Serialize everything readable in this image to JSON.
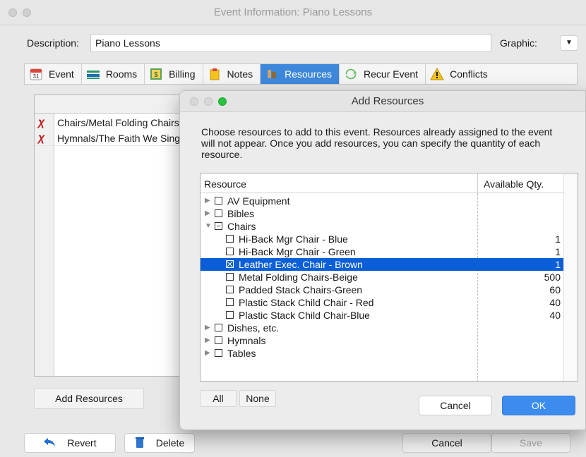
{
  "window": {
    "title": "Event Information: Piano Lessons"
  },
  "description": {
    "label": "Description:",
    "value": "Piano Lessons",
    "graphic_label": "Graphic:"
  },
  "tabs": [
    {
      "label": "Event",
      "icon": "calendar-icon",
      "icon_text": "31"
    },
    {
      "label": "Rooms",
      "icon": "rooms-icon"
    },
    {
      "label": "Billing",
      "icon": "billing-icon"
    },
    {
      "label": "Notes",
      "icon": "notes-icon"
    },
    {
      "label": "Resources",
      "icon": "resources-icon"
    },
    {
      "label": "Recur Event",
      "icon": "recur-icon"
    },
    {
      "label": "Conflicts",
      "icon": "warning-icon"
    }
  ],
  "assigned_resources": [
    {
      "name": "Chairs/Metal Folding Chairs"
    },
    {
      "name": "Hymnals/The Faith We Sing"
    }
  ],
  "buttons": {
    "add_resources": "Add Resources",
    "revert": "Revert",
    "delete": "Delete",
    "cancel": "Cancel",
    "save": "Save"
  },
  "dialog": {
    "title": "Add Resources",
    "instructions": "Choose resources to add to this event. Resources already assigned to the event will not appear. Once you add resources, you can specify the quantity of each resource.",
    "col_resource": "Resource",
    "col_qty": "Available Qty.",
    "rows": [
      {
        "label": "AV Equipment",
        "qty": ""
      },
      {
        "label": "Bibles",
        "qty": ""
      },
      {
        "label": "Chairs",
        "qty": ""
      },
      {
        "label": "Hi-Back Mgr Chair - Blue",
        "qty": "1"
      },
      {
        "label": "Hi-Back Mgr Chair - Green",
        "qty": "1"
      },
      {
        "label": "Leather Exec. Chair - Brown",
        "qty": "1"
      },
      {
        "label": "Metal Folding Chairs-Beige",
        "qty": "500"
      },
      {
        "label": "Padded Stack Chairs-Green",
        "qty": "60"
      },
      {
        "label": "Plastic Stack Child Chair - Red",
        "qty": "40"
      },
      {
        "label": "Plastic Stack Child Chair-Blue",
        "qty": "40"
      },
      {
        "label": "Dishes, etc.",
        "qty": ""
      },
      {
        "label": "Hymnals",
        "qty": ""
      },
      {
        "label": "Tables",
        "qty": ""
      }
    ],
    "all_label": "All",
    "none_label": "None",
    "cancel_label": "Cancel",
    "ok_label": "OK"
  },
  "colors": {
    "accent": "#3e88dc",
    "selection": "#0a5fd6",
    "remove": "#c02020"
  }
}
